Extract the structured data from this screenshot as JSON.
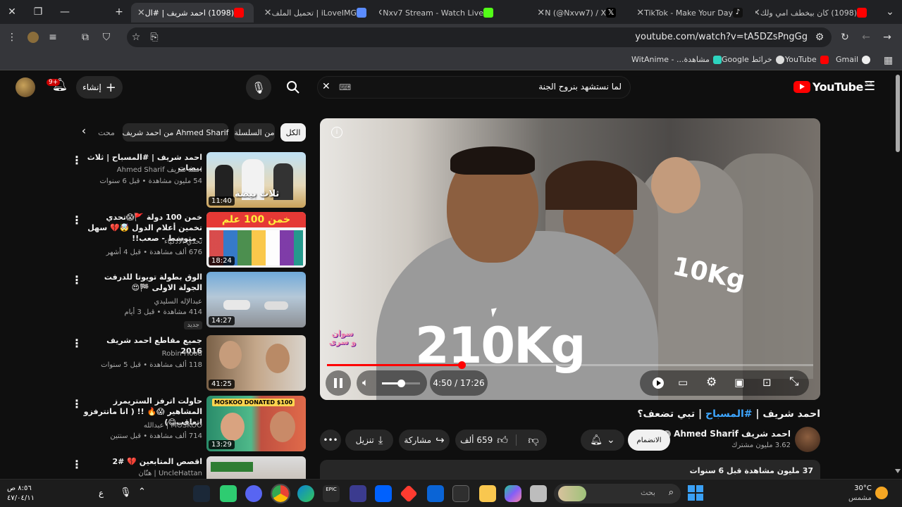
{
  "tabs": [
    {
      "title": "(1098) كان بيخطف امي ولك",
      "color": "#ff0000"
    },
    {
      "title": "TikTok - Make Your Day",
      "color": "#111111"
    },
    {
      "title": "N (@Nxvw7) / X",
      "color": "#000000"
    },
    {
      "title": "Nxv7 Stream - Watch Live",
      "color": "#53fc18"
    },
    {
      "title": "iLoveIMG | تحميل الملف",
      "color": "#5b8cff"
    },
    {
      "title": "(1098) احمد شريف | #ال",
      "color": "#ff0000"
    }
  ],
  "address_bar": {
    "url": "youtube.com/watch?v=tA5DZsPngGg"
  },
  "bookmarks": [
    "Gmail",
    "YouTube",
    "خرائط Google",
    "مشاهدة... - WitAnime"
  ],
  "youtube": {
    "logo_text": "YouTube",
    "region": "SA",
    "search_query": "لما نستشهد بنروح الجنة",
    "create_label": "إنشاء",
    "notifications_badge": "9+"
  },
  "chips": [
    "الكل",
    "من السلسلة",
    "من احمد شريف Ahmed Sharif",
    "محت"
  ],
  "recommendations": [
    {
      "title": "احمد شريف | #المسباح | ثلاث بيضات",
      "channel": "احمد شريف Ahmed Sharif",
      "meta": "54 مليون مشاهدة • قبل 6 سنوات",
      "duration": "11:40",
      "thumb_text": "ثلاث بيضة",
      "badge": ""
    },
    {
      "title": "خمن 100 دولة 🚩😱تحدي تخمين أعلام الدول 🤯💔 سهل - متوسط - صعب!!",
      "channel": "تحدي الأذكياء",
      "meta": "676 ألف مشاهدة • قبل 4 أشهر",
      "duration": "18:24",
      "thumb_text": "خمن 100 علم",
      "badge": ""
    },
    {
      "title": "الوق بطولة تويوتا للدرفت الجولة الاولى 🏁😍",
      "channel": "عبدالإله السليدي",
      "meta": "414 مشاهدة • قبل 3 أيام",
      "duration": "14:27",
      "thumb_text": "",
      "badge": "جديد"
    },
    {
      "title": "جميع مقاطع احمد شريف 2016",
      "channel": "Robin Hood",
      "meta": "118 ألف مشاهدة • قبل 5 سنوات",
      "duration": "41:25",
      "thumb_text": "",
      "badge": ""
    },
    {
      "title": "حاولت اترفز الستريمرز المشاهير 😱🔥 !! ( انا ماتترفزو اتعاقب😋)",
      "channel": "MOSKOO | عبدالله",
      "meta": "714 ألف مشاهدة • قبل سنتين",
      "duration": "13:29",
      "thumb_text": "MOSKOO DONATED $100",
      "badge": ""
    },
    {
      "title": "اقصص المتابعين 💔 #2",
      "channel": "UncleHattan | هتّان",
      "meta": "",
      "duration": "",
      "thumb_text": "",
      "badge": ""
    }
  ],
  "player": {
    "time": "4:50 / 17:26",
    "progress": 0.277,
    "volume": 0.5,
    "overlay_text": "210Kg",
    "shirt_text": "10Kg",
    "watermark": "سوان و سرى"
  },
  "video": {
    "title_prefix": "احمد شريف | ",
    "title_hashtag": "#المسباح",
    "title_suffix": " | تبي تضعف؟",
    "channel_name": "احمد شريف Ahmed Sharif",
    "subscribers": "3.62 مليون مشترك",
    "subscribe_label": "الانضمام",
    "likes": "659 ألف",
    "share_label": "مشاركة",
    "download_label": "تنزيل",
    "desc_meta": "37 مليون مشاهدة  قبل 6 سنوات"
  },
  "taskbar": {
    "weather_temp": "30°C",
    "weather_desc": "مشمس",
    "search_placeholder": "بحث",
    "clock_time": "٨:٥٦ ص",
    "clock_date": "٤٧/٠٤/١١",
    "lang": "ع"
  },
  "colors": {
    "yt_red": "#ff0000",
    "bg": "#0f0f0f",
    "surface": "#272727",
    "link": "#3ea6ff"
  }
}
